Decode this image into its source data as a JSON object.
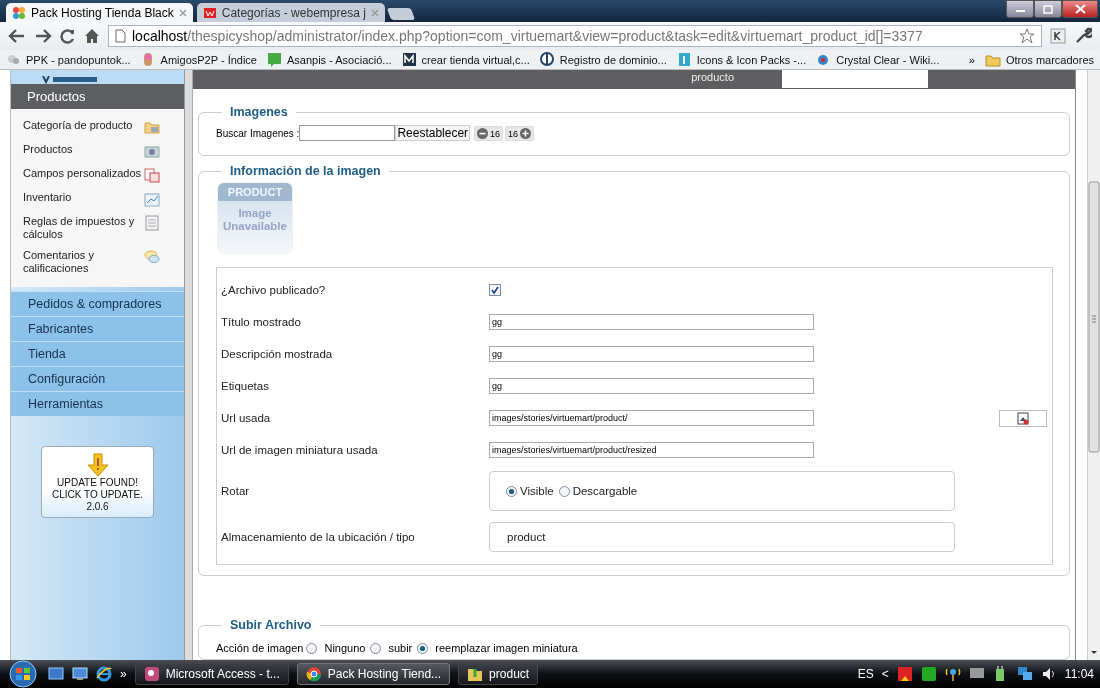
{
  "browser": {
    "tabs": [
      {
        "title": "Pack Hosting Tienda Black",
        "selected": true
      },
      {
        "title": "Categorías - webempresa j",
        "selected": false
      }
    ],
    "url_host": "localhost",
    "url_path": "/thespicyshop/administrator/index.php?option=com_virtuemart&view=product&task=edit&virtuemart_product_id[]=3377",
    "bookmarks": [
      "PPK - pandopuntok...",
      "AmigosP2P - Índice",
      "Asanpis - Asociació...",
      "crear tienda virtual,c...",
      "Registro de dominio...",
      "Icons & Icon Packs -...",
      "Crystal Clear - Wiki..."
    ],
    "bookmarks_more": "»",
    "other_bookmarks": "Otros marcadores"
  },
  "sidebar": {
    "section": "Productos",
    "items": [
      "Categoría de producto",
      "Productos",
      "Campos personalizados",
      "Inventario",
      "Reglas de impuestos y cálculos",
      "Comentarios y calificaciones"
    ],
    "menus": [
      "Pedidos & compradores",
      "Fabricantes",
      "Tienda",
      "Configuración",
      "Herramientas"
    ],
    "update_notice": "UPDATE FOUND! CLICK TO UPDATE.",
    "update_version": "2.0.6"
  },
  "top_strip": {
    "label": "producto"
  },
  "images_section": {
    "legend": "Imagenes",
    "search_label": "Buscar Imagenes :",
    "reset_button": "Reestablecer",
    "prev_count": "16",
    "next_count": "16"
  },
  "image_info": {
    "legend": "Información de la imagen",
    "thumbnail_header": "PRODUCT",
    "thumbnail_caption": "Image Unavailable",
    "fields": [
      {
        "kind": "checkbox",
        "label": "¿Archivo publicado?",
        "checked": true
      },
      {
        "kind": "text",
        "label": "Título mostrado",
        "value": "gg"
      },
      {
        "kind": "text",
        "label": "Descripción mostrada",
        "value": "gg"
      },
      {
        "kind": "text",
        "label": "Etiquetas",
        "value": "gg"
      },
      {
        "kind": "text",
        "label": "Url usada",
        "value": "images/stories/virtuemart/product/",
        "side_button": true
      },
      {
        "kind": "text",
        "label": "Url de imagen miniatura usada",
        "value": "images/stories/virtuemart/product/resized"
      },
      {
        "kind": "radio",
        "label": "Rotar",
        "options": [
          {
            "label": "Visible",
            "selected": true
          },
          {
            "label": "Descargable",
            "selected": false
          }
        ]
      },
      {
        "kind": "static",
        "label": "Almacenamiento de la ubicación / tipo",
        "value": "product"
      }
    ]
  },
  "upload": {
    "legend": "Subir Archivo",
    "label": "Acción de imagen",
    "options": [
      {
        "label": "Ninguno",
        "selected": false
      },
      {
        "label": "subir",
        "selected": false
      },
      {
        "label": "reemplazar imagen miniatura",
        "selected": true
      }
    ]
  },
  "taskbar": {
    "quick_more": "»",
    "buttons": [
      {
        "label": "Microsoft Access - t...",
        "selected": false
      },
      {
        "label": "Pack Hosting Tiend...",
        "selected": true
      },
      {
        "label": "product",
        "selected": false
      }
    ],
    "language": "ES",
    "tray_expand": "<",
    "time": "11:04"
  }
}
